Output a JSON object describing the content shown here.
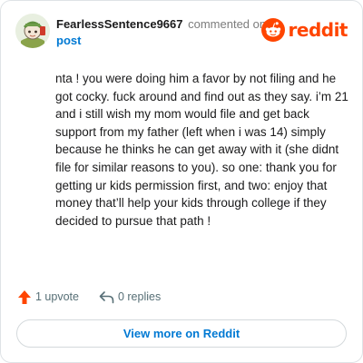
{
  "header": {
    "author": "FearlessSentence9667",
    "commented_on": "commented on",
    "post_link": "post",
    "brand": "reddit"
  },
  "comment": {
    "text": "nta ! you were doing him a favor by not filing and he got cocky. fuck around and find out as they say. i’m 21 and i still wish my mom would file and get back support from my father (left when i was 14) simply because he thinks he can get away with it (she didnt file for similar reasons to you). so one: thank you for getting ur kids permission first, and two: enjoy that money that’ll help your kids through college if they decided to pursue that path !"
  },
  "actions": {
    "upvotes": "1 upvote",
    "replies": "0 replies"
  },
  "footer": {
    "view_more": "View more on Reddit"
  },
  "colors": {
    "brand": "#ff4500",
    "link": "#0079d3",
    "upvote_icon": "#ff4500",
    "muted": "#576f76"
  },
  "icons": {
    "reddit_logo": "reddit-snoo-icon",
    "upvote": "upvote-arrow-icon",
    "reply": "reply-arrow-icon"
  }
}
